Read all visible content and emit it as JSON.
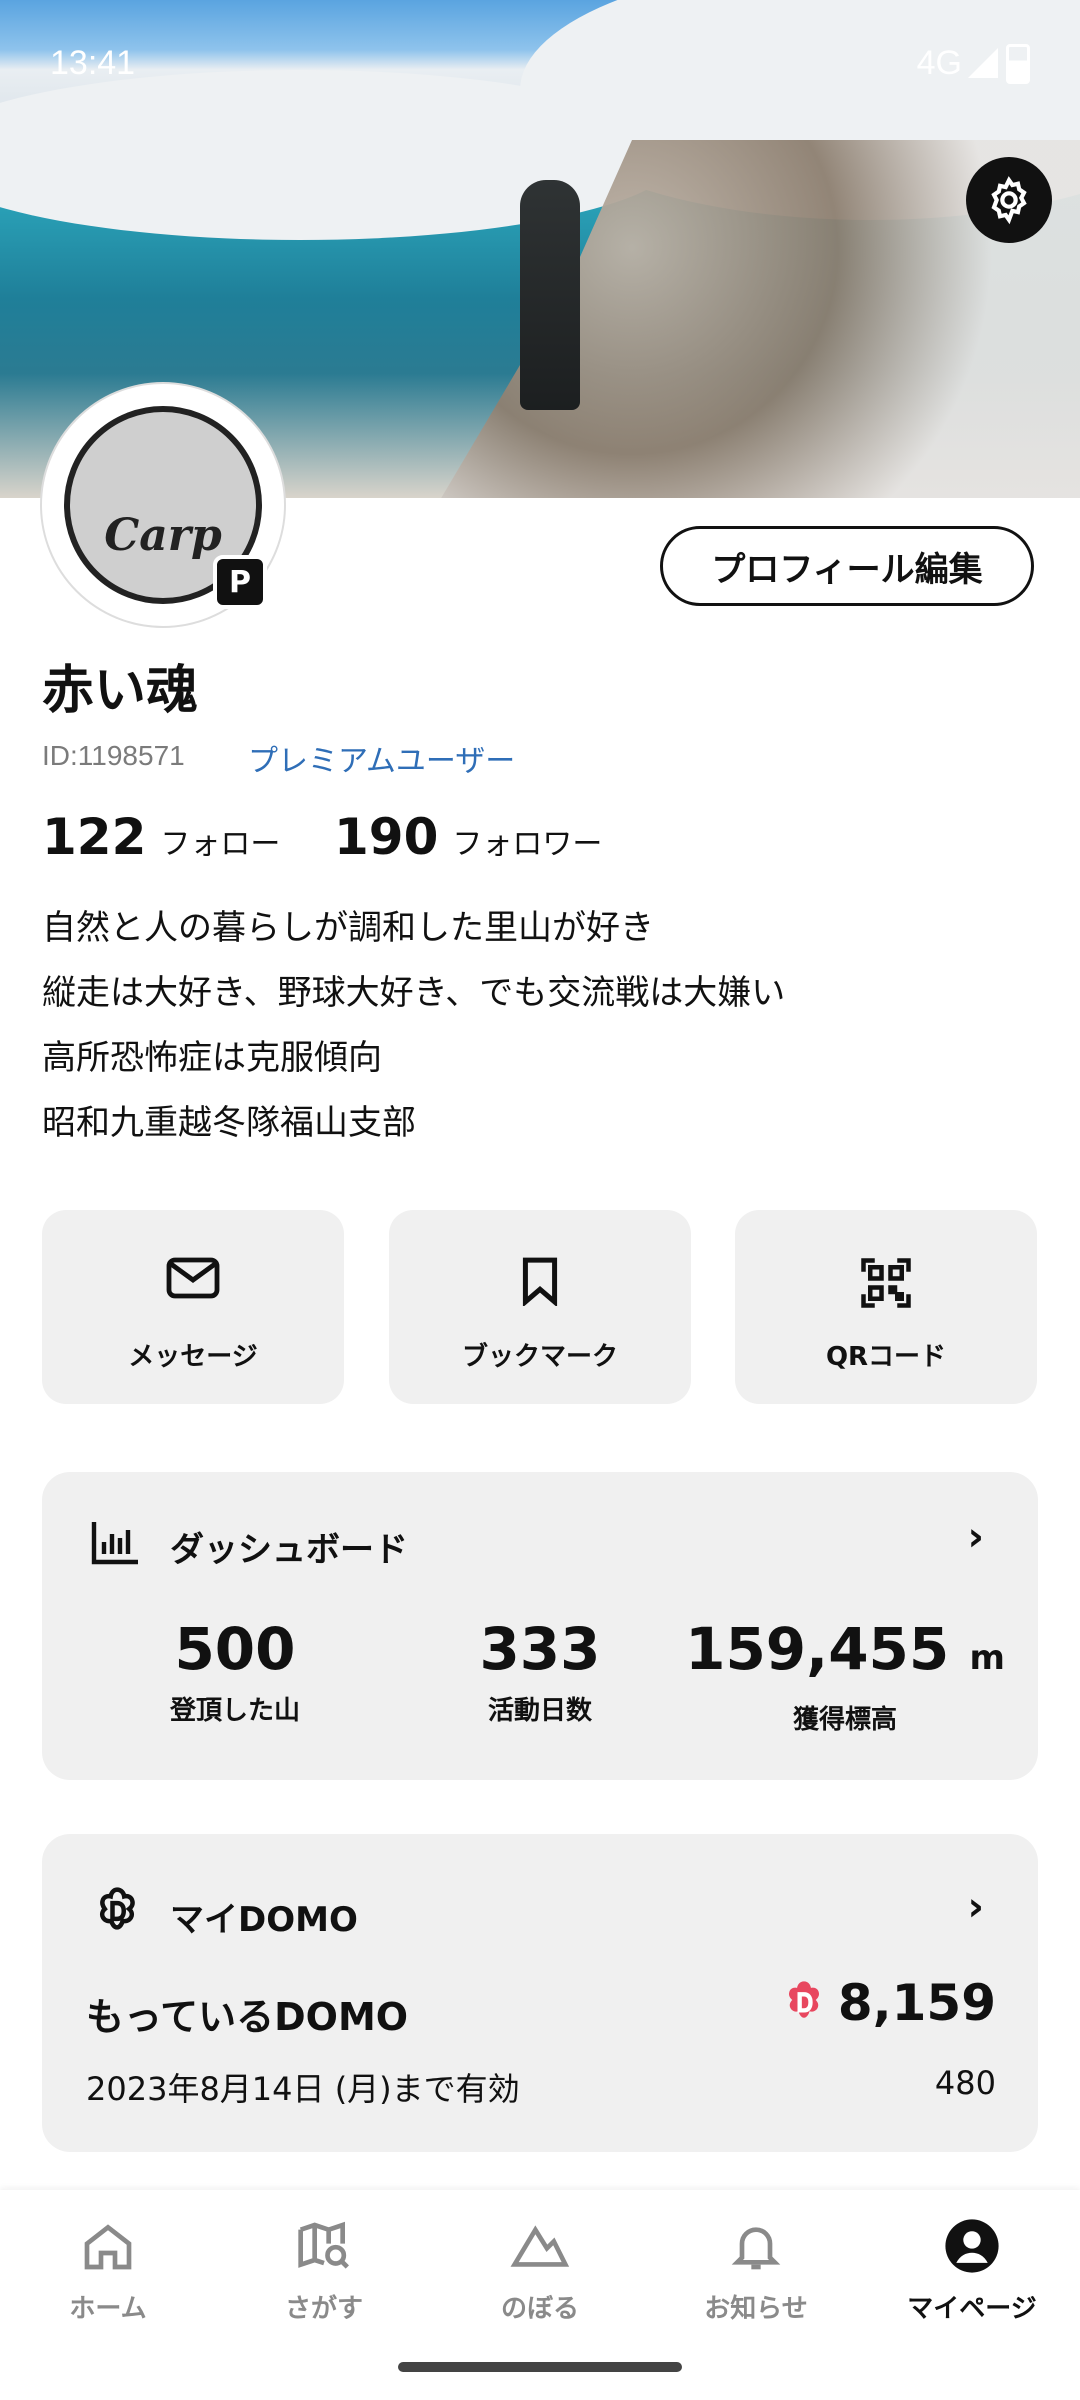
{
  "status_bar": {
    "time": "13:41",
    "network": "4G"
  },
  "profile": {
    "edit_button": "プロフィール編集",
    "avatar_text": "Carp",
    "badge": "P",
    "name": "赤い魂",
    "user_id": "ID:1198571",
    "membership": "プレミアムユーザー",
    "follow_count": "122",
    "follow_label": "フォロー",
    "follower_count": "190",
    "follower_label": "フォロワー",
    "bio": [
      "自然と人の暮らしが調和した里山が好き",
      "縦走は大好き、野球大好き、でも交流戦は大嫌い",
      "高所恐怖症は克服傾向",
      "昭和九重越冬隊福山支部"
    ]
  },
  "actions": [
    {
      "label": "メッセージ",
      "icon": "mail-icon"
    },
    {
      "label": "ブックマーク",
      "icon": "bookmark-icon"
    },
    {
      "label": "QRコード",
      "icon": "qr-code-icon"
    }
  ],
  "dashboard": {
    "title": "ダッシュボード",
    "stats": [
      {
        "value": "500",
        "unit": "",
        "label": "登頂した山"
      },
      {
        "value": "333",
        "unit": "",
        "label": "活動日数"
      },
      {
        "value": "159,455",
        "unit": "m",
        "label": "獲得標高"
      }
    ]
  },
  "domo": {
    "title": "マイDOMO",
    "held_label": "もっているDOMO",
    "amount": "8,159",
    "expiry": "2023年8月14日 (月)まで有効",
    "expiring_amount": "480",
    "accent": "#e8475f"
  },
  "nav": [
    {
      "label": "ホーム",
      "icon": "home-icon"
    },
    {
      "label": "さがす",
      "icon": "map-search-icon"
    },
    {
      "label": "のぼる",
      "icon": "mountain-icon"
    },
    {
      "label": "お知らせ",
      "icon": "bell-icon"
    },
    {
      "label": "マイページ",
      "icon": "user-icon",
      "active": true
    }
  ]
}
